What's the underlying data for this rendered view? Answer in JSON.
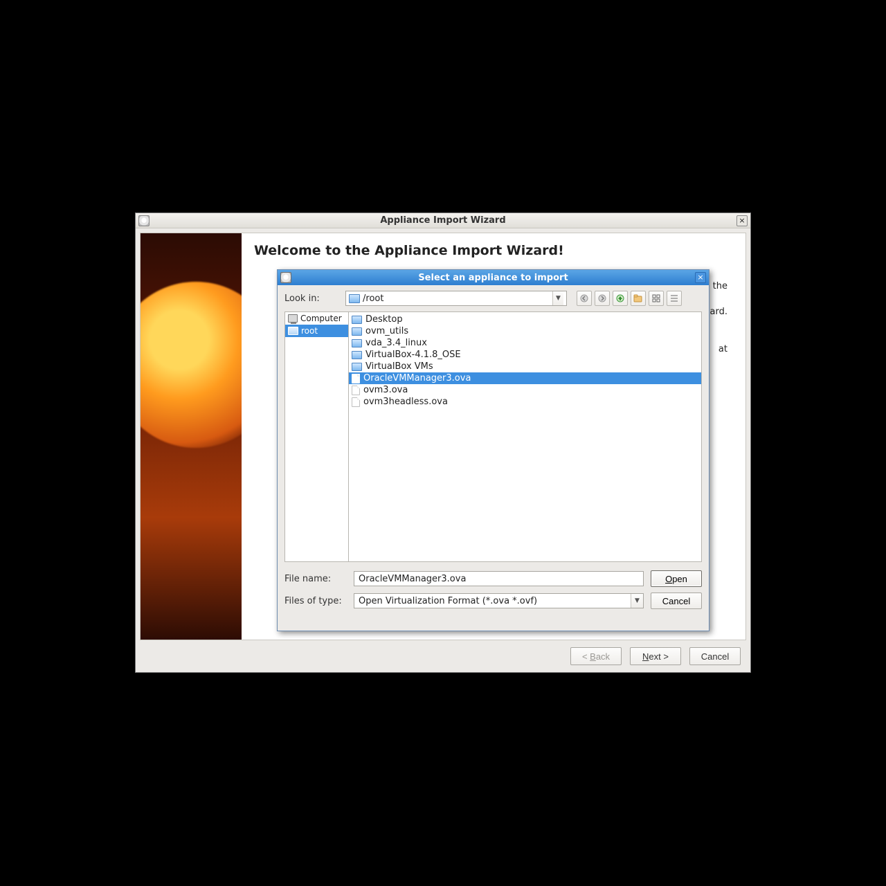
{
  "wizard": {
    "title": "Appliance Import Wizard",
    "heading": "Welcome to the Appliance Import Wizard!",
    "body_visible_right_fragment_1": "to the",
    "body_visible_right_fragment_2": "izard.",
    "body_visible_right_fragment_3": "at",
    "buttons": {
      "back": "< Back",
      "next": "Next >",
      "cancel": "Cancel"
    }
  },
  "file_dialog": {
    "title": "Select an appliance to import",
    "look_in_label": "Look in:",
    "look_in_value": "/root",
    "places": [
      {
        "label": "Computer",
        "icon": "computer",
        "selected": false
      },
      {
        "label": "root",
        "icon": "folder",
        "selected": true
      }
    ],
    "entries": [
      {
        "name": "Desktop",
        "type": "folder",
        "selected": false
      },
      {
        "name": "ovm_utils",
        "type": "folder",
        "selected": false
      },
      {
        "name": "vda_3.4_linux",
        "type": "folder",
        "selected": false
      },
      {
        "name": "VirtualBox-4.1.8_OSE",
        "type": "folder",
        "selected": false
      },
      {
        "name": "VirtualBox VMs",
        "type": "folder",
        "selected": false
      },
      {
        "name": "OracleVMManager3.ova",
        "type": "file",
        "selected": true
      },
      {
        "name": "ovm3.ova",
        "type": "file",
        "selected": false
      },
      {
        "name": "ovm3headless.ova",
        "type": "file",
        "selected": false
      }
    ],
    "file_name_label": "File name:",
    "file_name_value": "OracleVMManager3.ova",
    "files_of_type_label": "Files of type:",
    "files_of_type_value": "Open Virtualization Format (*.ova *.ovf)",
    "buttons": {
      "open": "Open",
      "cancel": "Cancel"
    }
  }
}
